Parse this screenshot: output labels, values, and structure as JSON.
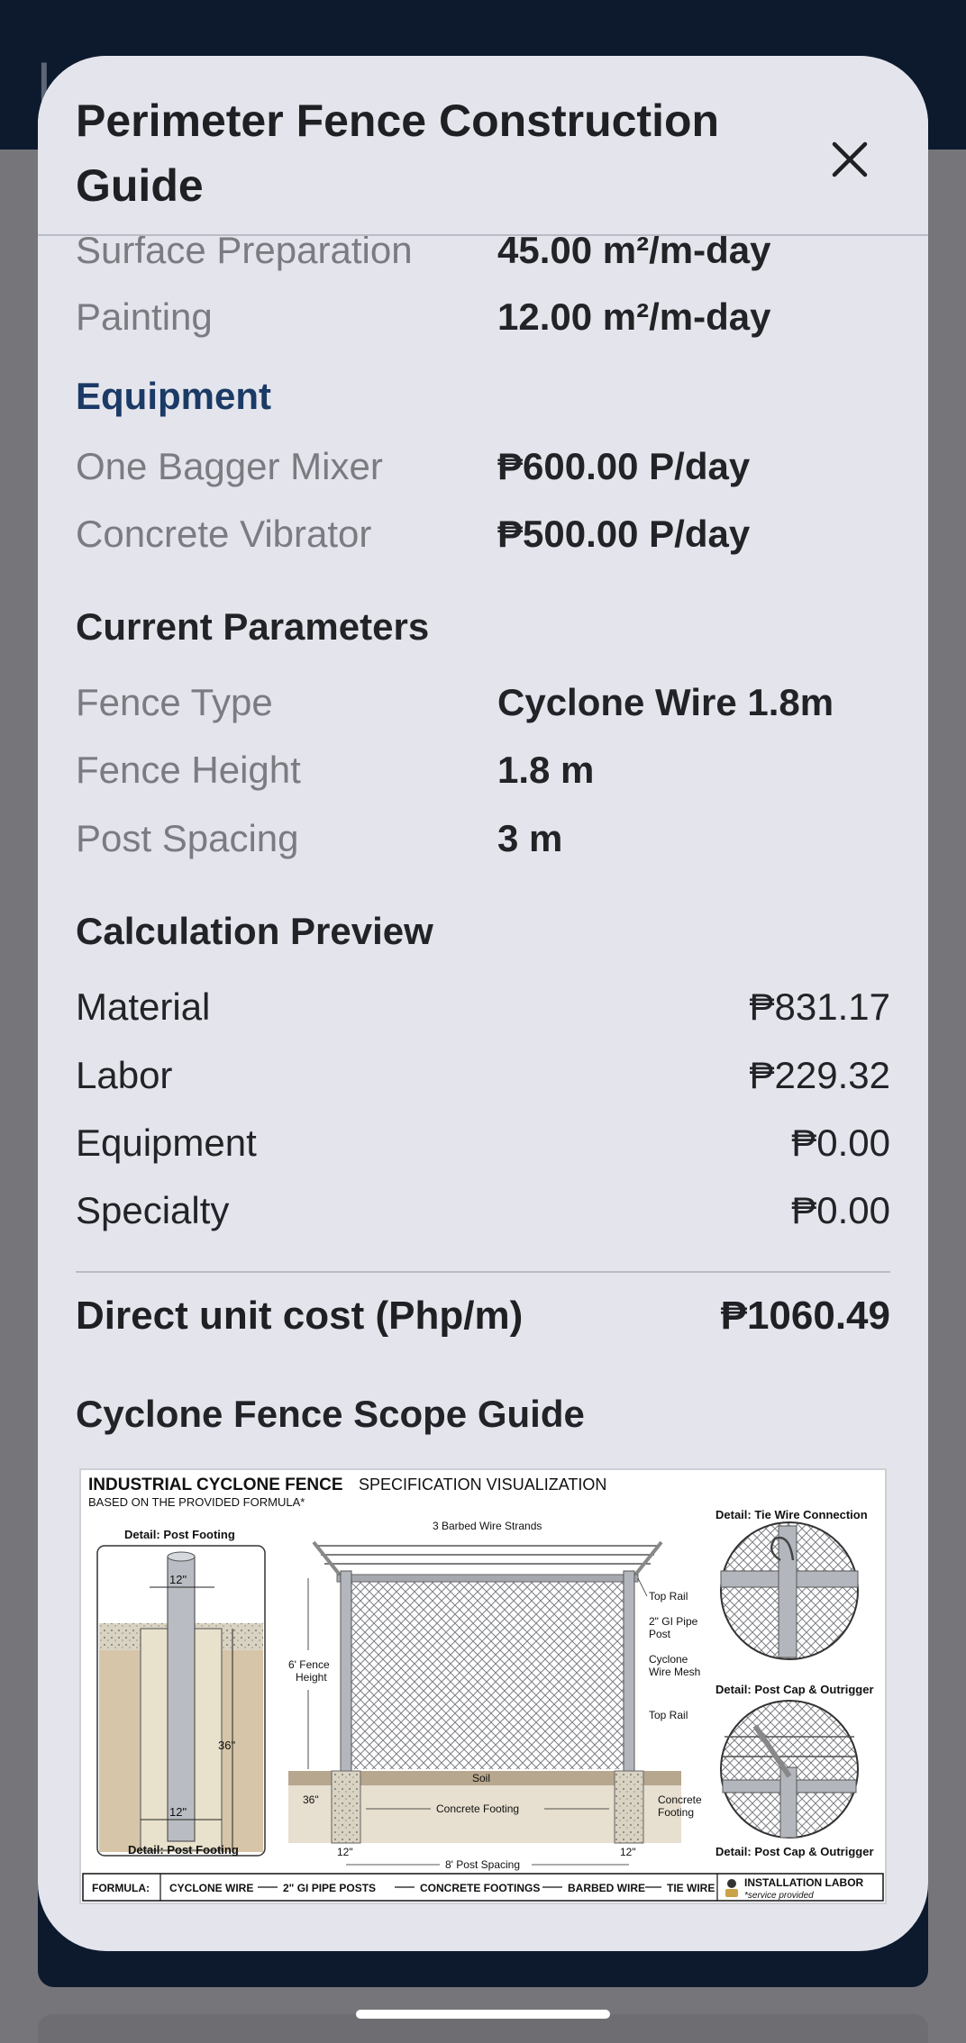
{
  "background": {
    "header_letter": "L"
  },
  "modal": {
    "title": "Perimeter Fence Construction Guide",
    "close_icon": "close-icon"
  },
  "productivity": [
    {
      "label": "Surface Preparation",
      "value": "45.00 m²/m-day"
    },
    {
      "label": "Painting",
      "value": "12.00 m²/m-day"
    }
  ],
  "equipment": {
    "title": "Equipment",
    "items": [
      {
        "label": "One Bagger Mixer",
        "value": "₱600.00 P/day"
      },
      {
        "label": "Concrete Vibrator",
        "value": "₱500.00 P/day"
      }
    ]
  },
  "current_parameters": {
    "title": "Current Parameters",
    "items": [
      {
        "label": "Fence Type",
        "value": "Cyclone Wire 1.8m"
      },
      {
        "label": "Fence Height",
        "value": "1.8 m"
      },
      {
        "label": "Post Spacing",
        "value": "3 m"
      }
    ]
  },
  "calculation_preview": {
    "title": "Calculation Preview",
    "items": [
      {
        "label": "Material",
        "value": "₱831.17"
      },
      {
        "label": "Labor",
        "value": "₱229.32"
      },
      {
        "label": "Equipment",
        "value": "₱0.00"
      },
      {
        "label": "Specialty",
        "value": "₱0.00"
      }
    ],
    "total_label": "Direct unit cost (Php/m)",
    "total_value": "₱1060.49"
  },
  "scope_guide": {
    "title": "Cyclone Fence Scope Guide",
    "figure": {
      "heading_bold": "INDUSTRIAL CYCLONE FENCE",
      "heading_rest": "SPECIFICATION VISUALIZATION",
      "subheading": "BASED ON THE PROVIDED FORMULA*",
      "detail_post_footing": "Detail: Post Footing",
      "detail_tie_wire": "Detail: Tie Wire Connection",
      "detail_post_cap": "Detail: Post Cap & Outrigger",
      "dim_12": "12\"",
      "dim_36": "36\"",
      "barbed_wire": "3 Barbed Wire Strands",
      "top_rail": "Top Rail",
      "gi_pipe_post_1": "2\" GI Pipe",
      "gi_pipe_post_2": "Post",
      "cyclone_mesh_1": "Cyclone",
      "cyclone_mesh_2": "Wire Mesh",
      "fence_height_1": "6' Fence",
      "fence_height_2": "Height",
      "soil": "Soil",
      "concrete_footing": "Concrete Footing",
      "concrete_footing_1": "Concrete",
      "concrete_footing_2": "Footing",
      "post_spacing": "8' Post Spacing",
      "formula_label": "FORMULA:",
      "formula_items": [
        "CYCLONE WIRE",
        "2\" GI PIPE POSTS",
        "CONCRETE FOOTINGS",
        "BARBED WIRE",
        "TIE WIRE"
      ],
      "installation_labor": "INSTALLATION LABOR",
      "service_provided": "*service provided"
    }
  }
}
